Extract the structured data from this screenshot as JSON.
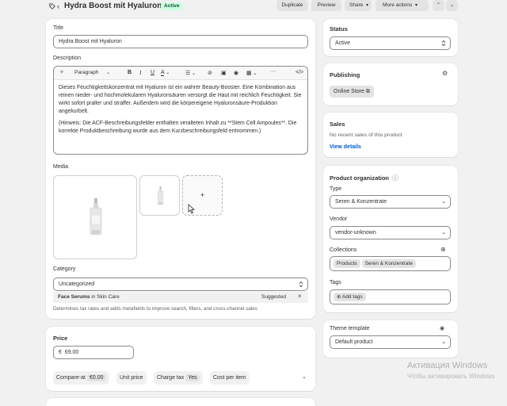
{
  "header": {
    "title": "Hydra Boost mit Hyaluron",
    "status_badge": "Active",
    "duplicate": "Duplicate",
    "preview": "Preview",
    "share": "Share",
    "more_actions": "More actions"
  },
  "title_field": {
    "label": "Title",
    "value": "Hydra Boost mit Hyaluron"
  },
  "description": {
    "label": "Description",
    "paragraph_style": "Paragraph",
    "p1": "Dieses Feuchtigkeitskonzentrat mit Hyaluron ist ein wahrer Beauty-Booster. Eine Kombination aus reinen nieder- und hochmolekularen Hyaluronsäuren versorgt die Haut mit reichlich Feuchtigkeit. Sie wirkt sofort praller und straffer. Außerdem wird die körpereigene Hyaluronsäure-Produktion angekurbelt.",
    "p2": "(Hinweis: Die ACF-Beschreibungsfelder enthalten veralteten Inhalt zu **Stem Cell Ampoules**. Die korrekte Produktbeschreibung wurde aus dem Kurzbeschreibungsfeld entnommen.)"
  },
  "media": {
    "label": "Media",
    "add": "+"
  },
  "category": {
    "label": "Category",
    "value": "Uncategorized",
    "suggestion_name": "Face Serums",
    "suggestion_in": "in Skin Care",
    "suggested": "Suggested",
    "help": "Determines tax rates and adds metafields to improve search, filters, and cross-channel sales"
  },
  "price": {
    "label": "Price",
    "currency": "€",
    "value": "69.00",
    "compare_at": "Compare-at",
    "compare_at_value": "€0.00",
    "unit_price": "Unit price",
    "charge_tax": "Charge tax",
    "charge_tax_value": "Yes",
    "cost_per_item": "Cost per item"
  },
  "status": {
    "label": "Status",
    "value": "Active"
  },
  "publishing": {
    "label": "Publishing",
    "channel": "Online Store"
  },
  "sales": {
    "label": "Sales",
    "text": "No recent sales of this product",
    "link": "View details"
  },
  "organization": {
    "label": "Product organization",
    "type_label": "Type",
    "type_value": "Seren & Konzentrate",
    "vendor_label": "Vendor",
    "vendor_value": "vendor-unknown",
    "collections_label": "Collections",
    "collections": [
      "Products",
      "Seren & Konzentrate"
    ],
    "tags_label": "Tags",
    "add_tags": "Add tags"
  },
  "theme": {
    "label": "Theme template",
    "value": "Default product"
  },
  "watermark": {
    "line1": "Активация Windows",
    "line2": "Чтобы активировать Windows"
  },
  "icons": [
    "tag-icon",
    "chevron-left-icon",
    "ai-sparkle-icon",
    "bold-icon",
    "italic-icon",
    "underline-icon",
    "text-color-icon",
    "align-icon",
    "link-icon",
    "image-icon",
    "video-icon",
    "table-icon",
    "more-icon",
    "code-icon",
    "chevron-up-icon",
    "chevron-down-icon",
    "settings-icon",
    "info-icon",
    "add-circle-icon",
    "eye-icon",
    "close-icon",
    "cursor-icon"
  ]
}
